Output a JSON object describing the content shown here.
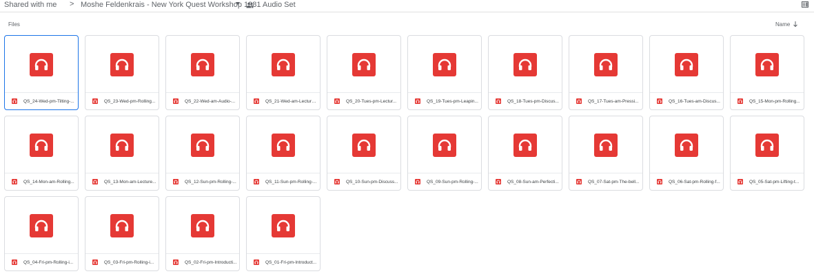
{
  "breadcrumb": {
    "root": "Shared with me",
    "separator": ">",
    "current": "Moshe Feldenkrais - New York Quest Workshop 1981 Audio Set"
  },
  "section": {
    "label": "Files"
  },
  "sort": {
    "label": "Name",
    "direction": "descending"
  },
  "colors": {
    "audio_icon": "#e53935",
    "selection": "#1a73e8"
  },
  "icons": {
    "file_type": "headphones-icon"
  },
  "files": [
    {
      "name": "QS_24-Wed-pm-Tilting-..."
    },
    {
      "name": "QS_23-Wed-pm-Rolling..."
    },
    {
      "name": "QS_22-Wed-am-Audio-..."
    },
    {
      "name": "QS_21-Wed-am-Lecture..."
    },
    {
      "name": "QS_20-Tues-pm-Lectur..."
    },
    {
      "name": "QS_19-Tues-pm-Leapin..."
    },
    {
      "name": "QS_18-Tues-pm-Discus..."
    },
    {
      "name": "QS_17-Tues-am-Pressi..."
    },
    {
      "name": "QS_16-Tues-am-Discus..."
    },
    {
      "name": "QS_15-Mon-pm-Rolling..."
    },
    {
      "name": "QS_14-Mon-am-Rolling..."
    },
    {
      "name": "QS_13-Mon-am-Lecture..."
    },
    {
      "name": "QS_12-Sun-pm-Rolling-..."
    },
    {
      "name": "QS_11-Sun-pm-Rolling-..."
    },
    {
      "name": "QS_10-Sun-pm-Discuss..."
    },
    {
      "name": "QS_09-Sun-pm-Rolling-..."
    },
    {
      "name": "QS_08-Sun-am-Perfecti..."
    },
    {
      "name": "QS_07-Sat-pm-The-bell..."
    },
    {
      "name": "QS_06-Sat-pm-Rolling-f..."
    },
    {
      "name": "QS_05-Sat-pm-Lifting-t..."
    },
    {
      "name": "QS_04-Fri-pm-Rolling-i..."
    },
    {
      "name": "QS_03-Fri-pm-Rolling-i..."
    },
    {
      "name": "QS_02-Fri-pm-Introducti..."
    },
    {
      "name": "QS_01-Fri-pm-Introduct..."
    }
  ]
}
